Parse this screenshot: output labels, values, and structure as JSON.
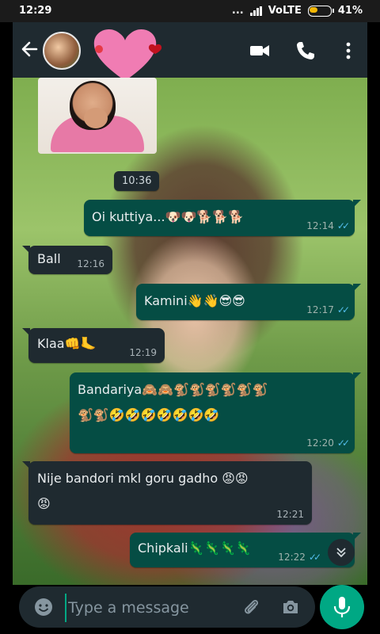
{
  "status": {
    "time": "12:29",
    "network": "VoLTE",
    "battery": "41%",
    "battery_level": 0.41,
    "dots": "..."
  },
  "toolbar": {
    "back_icon": "back-arrow-icon",
    "icons": [
      "video-call-icon",
      "voice-call-icon",
      "more-options-icon"
    ]
  },
  "chat": {
    "date_chip": "10:36",
    "messages": [
      {
        "dir": "out",
        "text": "Oi kuttiya...🐶🐶🐕🐕🐕",
        "time": "12:14",
        "read": true
      },
      {
        "dir": "in",
        "text": "Ball",
        "time": "12:16"
      },
      {
        "dir": "out",
        "text": "Kamini👋👋😎😎",
        "time": "12:17",
        "read": true
      },
      {
        "dir": "in",
        "text": "Klaa👊🦶",
        "time": "12:19"
      },
      {
        "dir": "out",
        "text": "Bandariya🙈🙈🐒🐒🐒🐒🐒🐒\n🐒🐒🤣🤣🤣🤣🤣🤣🤣",
        "time": "12:20",
        "read": true
      },
      {
        "dir": "in",
        "text": "Nije bandori mkl goru gadho 😡😡\n😡",
        "time": "12:21"
      },
      {
        "dir": "out",
        "text": "Chipkali🦎🦎🦎🦎",
        "time": "12:22",
        "read": true
      }
    ],
    "scroll_icon": "double-chevron-down-icon"
  },
  "composer": {
    "placeholder": "Type a message",
    "value": "",
    "icons": [
      "emoji-icon",
      "attach-icon",
      "camera-icon",
      "microphone-icon"
    ]
  },
  "colors": {
    "header": "#1f2a30",
    "incoming": "#1f2a30",
    "outgoing": "#054d44",
    "accent": "#00a884",
    "read_ticks": "#53bdeb"
  }
}
